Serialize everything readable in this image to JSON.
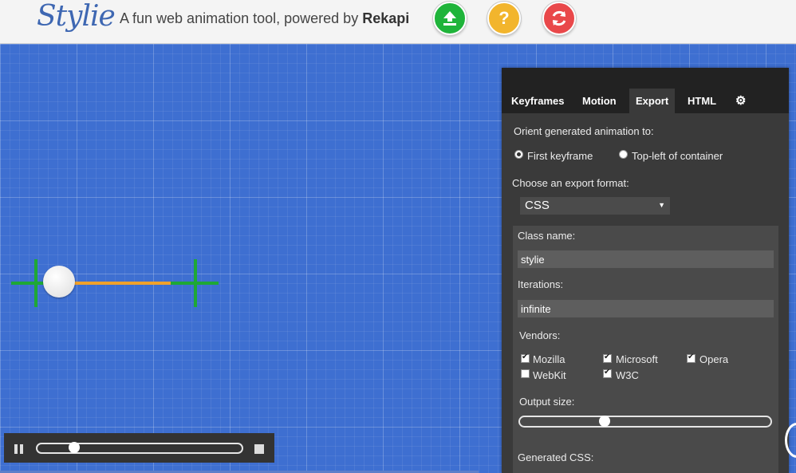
{
  "header": {
    "logo": "Stylie",
    "tagline_prefix": "A fun web animation tool, powered by ",
    "tagline_brand": "Rekapi",
    "buttons": [
      {
        "name": "upload",
        "color": "#1fb43a",
        "glyph": "⇪"
      },
      {
        "name": "help",
        "color": "#f2b52d",
        "glyph": "?"
      },
      {
        "name": "reset",
        "color": "#e9484a",
        "glyph": "⟳"
      }
    ]
  },
  "stage": {
    "grid_color": "#3e6fd1",
    "path_color": "#f0a12b",
    "keyframe_color": "#1ea836"
  },
  "playback": {
    "progress": 0.16
  },
  "panel": {
    "tabs": [
      "Keyframes",
      "Motion",
      "Export",
      "HTML"
    ],
    "active_tab": "Export",
    "settings_icon": "gear-icon",
    "orient_label": "Orient generated animation to:",
    "orient_options": [
      "First keyframe",
      "Top-left of container"
    ],
    "orient_selected": "First keyframe",
    "format_label": "Choose an export format:",
    "format_value": "CSS",
    "class_name_label": "Class name:",
    "class_name_value": "stylie",
    "iterations_label": "Iterations:",
    "iterations_value": "infinite",
    "vendors_label": "Vendors:",
    "vendors": [
      {
        "label": "Mozilla",
        "checked": true
      },
      {
        "label": "Microsoft",
        "checked": true
      },
      {
        "label": "Opera",
        "checked": true
      },
      {
        "label": "WebKit",
        "checked": false
      },
      {
        "label": "W3C",
        "checked": true
      }
    ],
    "output_size_label": "Output size:",
    "output_size_value": 0.33,
    "generated_label": "Generated CSS:"
  }
}
